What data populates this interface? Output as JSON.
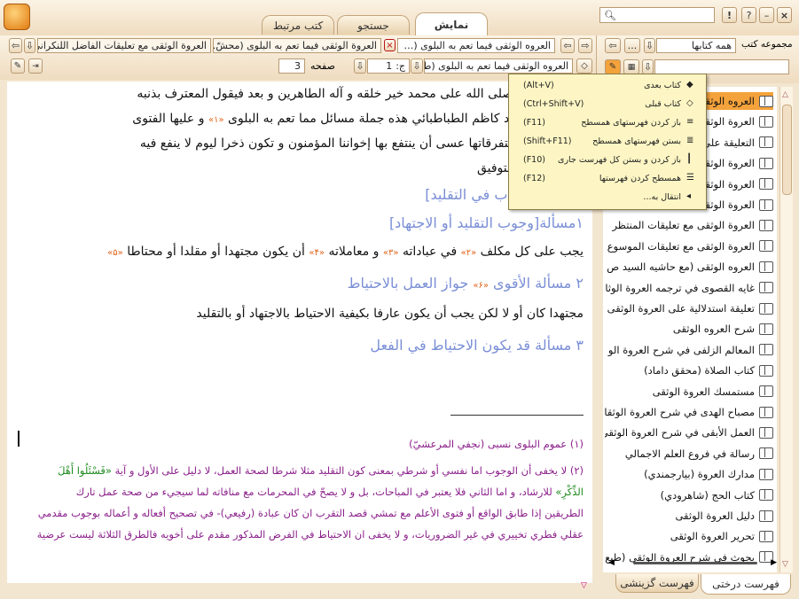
{
  "tabs": {
    "display": "نمایش",
    "search": "جستجو",
    "related": "کتب مرتبط"
  },
  "left_toolbar": {
    "doc_tab_1": "العروه الوثقی فیما تعم به البلوی (…",
    "doc_tab_2": "العروة الوثقی فیما تعم به البلوی (محشّ…",
    "doc_tab_3": "العروة الوثقی مع تعلیقات الفاضل اللنکرانی",
    "book_select": "العروه الوثقی فیما تعم به البلوی (طه…",
    "volume_label": "ج:",
    "volume_value": "1",
    "page_label": "صفحه",
    "page_value": "3"
  },
  "right_toolbar": {
    "collection_label": "مجموعه کتب",
    "collection_value": "همه کتابها",
    "dots": "..."
  },
  "main_text": {
    "l1": "ب العالمین و صلی الله علی محمد خیر خلقه و آله الطاهرین و بعد فیقول المعترف بذنبه",
    "l2": "رحمة ربه محمد کاظم الطباطبائي هذه جملة مسائل مما تعم به البلوی",
    "l2_fn": "«۱»",
    "l2_tail": "و علیها الفتوی",
    "l3": "تها و أحصیت متفرقاتها عسی أن ینتفع بها إخواننا المؤمنون و تكون ذخرا لیوم لا ینفع فیه",
    "l4": "ن و الله ولي التوفیق",
    "h1": "[باب في التقلید]",
    "h2": "۱مسألة[وجوب التقلید أو الاجتهاد]",
    "l5a": "یجب علی كل مكلف",
    "l5_fn2": "«۲»",
    "l5b": "في عباداته",
    "l5_fn3": "«۳»",
    "l5c": "و معاملاته",
    "l5_fn4": "«۴»",
    "l5d": "أن یكون مجتهدا أو مقلدا أو محتاطا",
    "l5_fn5": "«۵»",
    "h3a": "۲ مسألة الأقوی",
    "h3_fn": "«۶»",
    "h3b": "جواز العمل بالاحتیاط",
    "l6": "مجتهدا كان أو لا لكن یجب أن یكون عارفا بكیفیة الاحتیاط بالاجتهاد أو بالتقلید",
    "h4": "۳ مسألة قد یكون الاحتیاط في الفعل",
    "n1": "(۱) عموم البلوی نسبی (نجفي المرعشيّ)",
    "n2a": "(۲) لا یخفی أن الوجوب اما نفسي أو شرطي بمعنی كون التقلید مثلا شرطا لصحة العمل، لا دلیل علی الأول و آیة",
    "n2q": "«فَسْئَلُوا أَهْلَ",
    "n3q": "الذِّكْرِ»",
    "n3": "للارشاد، و اما الثاني فلا یعتبر في المباحات، بل و لا یصحّ في المحرمات مع منافاته لما سیجيء من صحة عمل تارك",
    "n4": "الطریقین إذا طابق الواقع أو فتوی الأعلم مع تمشي قصد التقرب ان كان عبادة (رفیعي)- في تصحیح أفعاله و أعماله بوجوب مقدمي",
    "n5": "عقلي فطري تخییري في غیر الضروریات، و لا یخفی ان الاحتیاط في الفرض المذكور مقدم علی أخویه فالطرق الثلاثة لیست عرضیة"
  },
  "tree": {
    "items": [
      "العروه الوثقی",
      "العروة الوثقی",
      "التعلیقة علی",
      "العروة الوثقی",
      "العروة الوثقی",
      "العروة الوثقی",
      "العروة الوثقی مع تعلیقات المنتظر",
      "العروة الوثقی مع تعلیقات الموسوع",
      "العروه الوثقی (مع حاشیه السید ص",
      "غایه القصوی في ترجمه العروة الوثا",
      "تعلیقة استدلالیة علی العروة الوثقی",
      "شرح العروه الوثقی",
      "المعالم الزلفی في شرح العروة الو",
      "كتاب الصلاة (محقق داماد)",
      "مستمسك العروة الوثقی",
      "مصباح الهدی في شرح العروة الوثقا",
      "العمل الأبقی في شرح العروة الوثقی",
      "رسالة في فروع العلم الاجمالي",
      "مدارك العروة (بیارجمندي)",
      "كتاب الحج (شاهرودي)",
      "دلیل العروة الوثقی",
      "تحریر العروة الوثقی",
      "بحوث في شرح العروة الوثقی (طبع"
    ]
  },
  "bottom_tabs": {
    "tree_list": "فهرست درختی",
    "select_list": "فهرست گزینشی"
  },
  "menu": {
    "items": [
      {
        "label": "كتاب بعدی",
        "shortcut": "(Alt+V)"
      },
      {
        "label": "كتاب قبلی",
        "shortcut": "(Ctrl+Shift+V)"
      },
      {
        "label": "باز كردن فهرستهای همسطح",
        "shortcut": "(F11)"
      },
      {
        "label": "بستن فهرستهای همسطح",
        "shortcut": "(Shift+F11)"
      },
      {
        "label": "باز كردن و بستن كل فهرست جاری",
        "shortcut": "(F10)"
      },
      {
        "label": "همسطح كردن فهرستها",
        "shortcut": "(F12)"
      },
      {
        "label": "انتقال به...",
        "shortcut": ""
      }
    ]
  },
  "colors": {
    "accent": "#f4a23b",
    "heading": "#7a8fd6",
    "footnote": "#e0641a",
    "note": "#8a1f8a",
    "quran": "#1d8a1d"
  }
}
